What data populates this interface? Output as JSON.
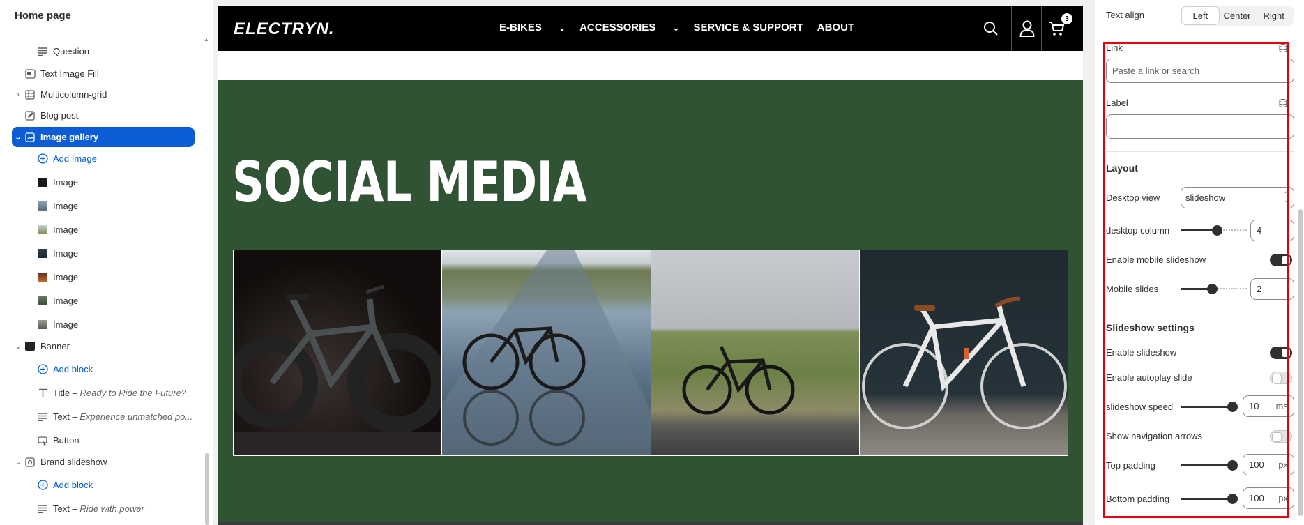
{
  "sidebar": {
    "title": "Home page",
    "items": [
      {
        "label": "Question",
        "type": "text"
      },
      {
        "label": "Text Image Fill"
      },
      {
        "label": "Multicolumn-grid"
      },
      {
        "label": "Blog post"
      },
      {
        "label": "Image gallery",
        "selected": true
      },
      {
        "label": "Add Image"
      },
      {
        "label": "Image"
      },
      {
        "label": "Image"
      },
      {
        "label": "Image"
      },
      {
        "label": "Image"
      },
      {
        "label": "Image"
      },
      {
        "label": "Image"
      },
      {
        "label": "Image"
      },
      {
        "label": "Banner"
      },
      {
        "label": "Add block"
      },
      {
        "label": "Title",
        "detail": "Ready to Ride the Future?"
      },
      {
        "label": "Text",
        "detail": "Experience unmatched po..."
      },
      {
        "label": "Button"
      },
      {
        "label": "Brand slideshow"
      },
      {
        "label": "Add block"
      },
      {
        "label": "Text",
        "detail": "Ride with power"
      }
    ]
  },
  "preview": {
    "logo": "ELECTRYN.",
    "menu": [
      "E-BIKES",
      "ACCESSORIES",
      "SERVICE & SUPPORT",
      "ABOUT"
    ],
    "cart_count": "3",
    "section_title": "SOCIAL MEDIA",
    "colors": {
      "section_bg": "#305333",
      "nav_bg": "#000000"
    }
  },
  "settings": {
    "text_align": {
      "label": "Text align",
      "options": [
        "Left",
        "Center",
        "Right"
      ],
      "selected": "Left"
    },
    "link": {
      "label": "Link",
      "placeholder": "Paste a link or search"
    },
    "label": {
      "label": "Label",
      "value": ""
    },
    "layout": {
      "heading": "Layout",
      "desktop_view": {
        "label": "Desktop view",
        "value": "slideshow"
      },
      "desktop_column": {
        "label": "desktop column",
        "value": "4"
      },
      "enable_mobile_slideshow": {
        "label": "Enable mobile slideshow",
        "on": true
      },
      "mobile_slides": {
        "label": "Mobile slides",
        "value": "2"
      }
    },
    "slideshow": {
      "heading": "Slideshow settings",
      "enable_slideshow": {
        "label": "Enable slideshow",
        "on": true
      },
      "enable_autoplay": {
        "label": "Enable autoplay slide",
        "on": false
      },
      "speed": {
        "label": "slideshow speed",
        "value": "10",
        "unit": "ms"
      },
      "show_arrows": {
        "label": "Show navigation arrows",
        "on": false
      },
      "top_padding": {
        "label": "Top padding",
        "value": "100",
        "unit": "px"
      },
      "bottom_padding": {
        "label": "Bottom padding",
        "value": "100",
        "unit": "px"
      }
    }
  }
}
